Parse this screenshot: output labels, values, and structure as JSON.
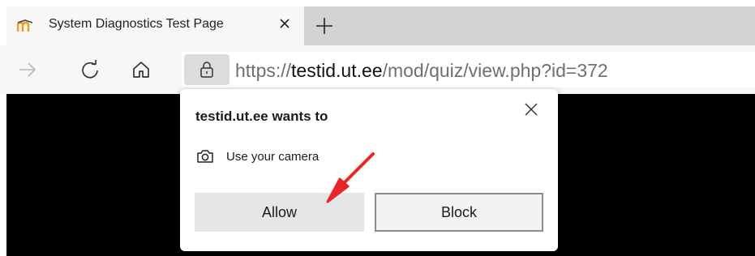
{
  "tab": {
    "title": "System Diagnostics Test Page",
    "favicon": "moodle-logo-icon",
    "close_icon": "close-icon"
  },
  "toolbar": {
    "icons": [
      "forward-arrow-icon",
      "refresh-icon",
      "home-icon",
      "lock-icon"
    ],
    "url_scheme": "https://",
    "url_host": "testid.ut.ee",
    "url_path": "/mod/quiz/view.php?id=372"
  },
  "popup": {
    "title": "testid.ut.ee wants to",
    "permission_icon": "camera-icon",
    "permission_label": "Use your camera",
    "allow_label": "Allow",
    "block_label": "Block"
  },
  "colors": {
    "annotation_arrow": "#e8262a",
    "page_background": "#000000"
  }
}
